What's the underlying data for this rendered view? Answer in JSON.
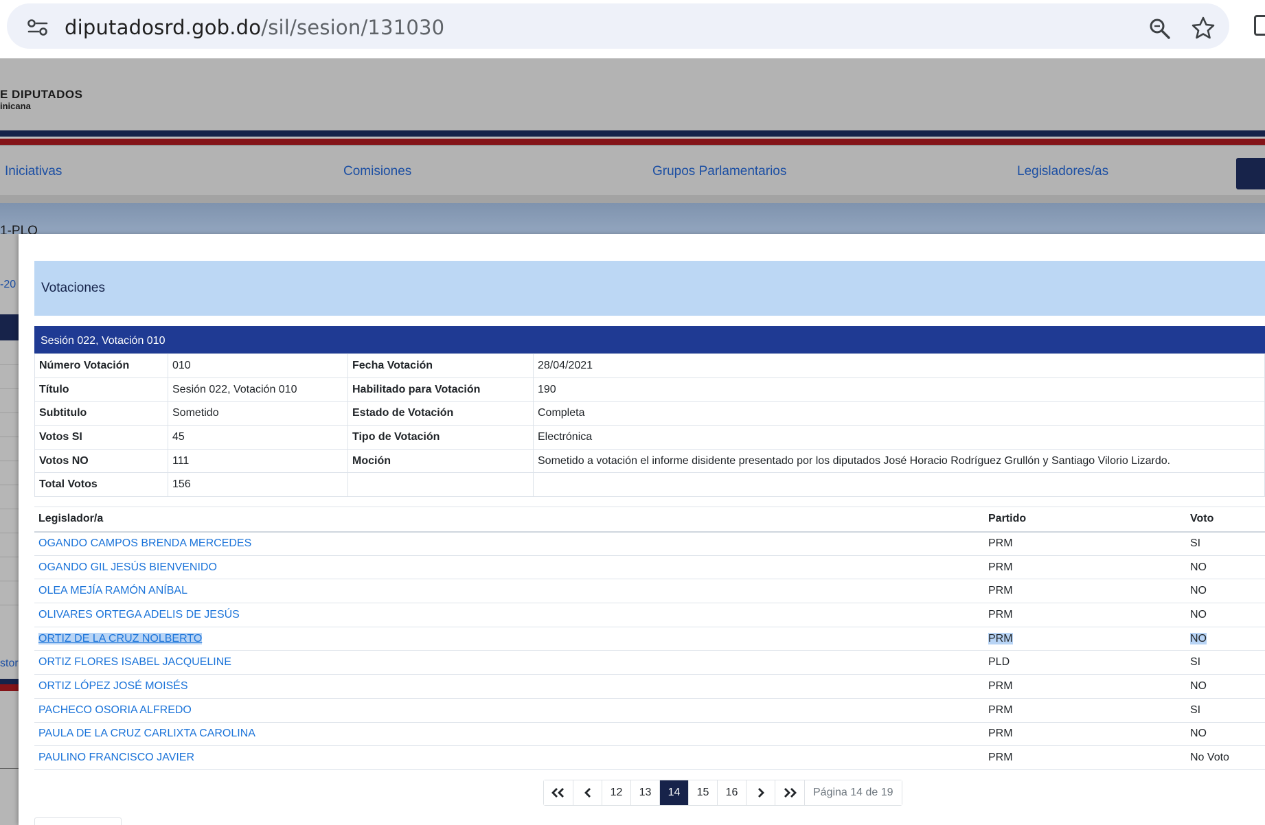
{
  "browser": {
    "url_domain": "diputadosrd.gob.do",
    "url_path": "/sil/sesion/131030"
  },
  "site": {
    "logo_text": "E DIPUTADOS",
    "logo_sub": "inicana",
    "nav": [
      "Iniciativas",
      "Comisiones",
      "Grupos Parlamentarios",
      "Legisladores/as"
    ],
    "breadcrumb_fragment": "1-PLO",
    "side_fragment_1": "-20",
    "side_fragment_2": "stori"
  },
  "modal": {
    "title": "Votaciones",
    "session_title": "Sesión 022, Votación 010",
    "details": [
      {
        "label1": "Número Votación",
        "value1": "010",
        "label2": "Fecha Votación",
        "value2": "28/04/2021"
      },
      {
        "label1": "Título",
        "value1": "Sesión 022, Votación 010",
        "label2": "Habilitado para Votación",
        "value2": "190"
      },
      {
        "label1": "Subtitulo",
        "value1": "Sometido",
        "label2": "Estado de Votación",
        "value2": "Completa"
      },
      {
        "label1": "Votos SI",
        "value1": "45",
        "label2": "Tipo de Votación",
        "value2": "Electrónica"
      },
      {
        "label1": "Votos NO",
        "value1": "111",
        "label2": "Moción",
        "value2": "Sometido a votación el informe disidente presentado por los diputados José Horacio Rodríguez Grullón y Santiago Vilorio Lizardo."
      },
      {
        "label1": "Total Votos",
        "value1": "156",
        "label2": "",
        "value2": ""
      }
    ],
    "votes_headers": {
      "legislator": "Legislador/a",
      "party": "Partido",
      "vote": "Voto"
    },
    "votes": [
      {
        "name": "OGANDO CAMPOS BRENDA MERCEDES",
        "party": "PRM",
        "vote": "SI"
      },
      {
        "name": "OGANDO GIL JESÚS BIENVENIDO",
        "party": "PRM",
        "vote": "NO"
      },
      {
        "name": "OLEA MEJÍA RAMÓN ANÍBAL",
        "party": "PRM",
        "vote": "NO"
      },
      {
        "name": "OLIVARES ORTEGA ADELIS DE JESÚS",
        "party": "PRM",
        "vote": "NO"
      },
      {
        "name": "ORTIZ DE LA CRUZ NOLBERTO",
        "party": "PRM",
        "vote": "NO"
      },
      {
        "name": "ORTIZ FLORES ISABEL JACQUELINE",
        "party": "PLD",
        "vote": "SI"
      },
      {
        "name": "ORTIZ LÓPEZ JOSÉ MOISÉS",
        "party": "PRM",
        "vote": "NO"
      },
      {
        "name": "PACHECO OSORIA ALFREDO",
        "party": "PRM",
        "vote": "SI"
      },
      {
        "name": "PAULA DE LA CRUZ CARLIXTA CAROLINA",
        "party": "PRM",
        "vote": "NO"
      },
      {
        "name": "PAULINO FRANCISCO JAVIER",
        "party": "PRM",
        "vote": "No Voto"
      }
    ],
    "selected_row": 4,
    "pagination": {
      "pages": [
        "12",
        "13",
        "14",
        "15",
        "16"
      ],
      "current": "14",
      "info": "Página 14 de 19"
    }
  },
  "colors": {
    "link": "#1a73d9",
    "session_bar": "#1f3a93",
    "modal_title_bg": "#bcd7f4",
    "active_page": "#17234a",
    "selection": "#b8d4f5"
  }
}
